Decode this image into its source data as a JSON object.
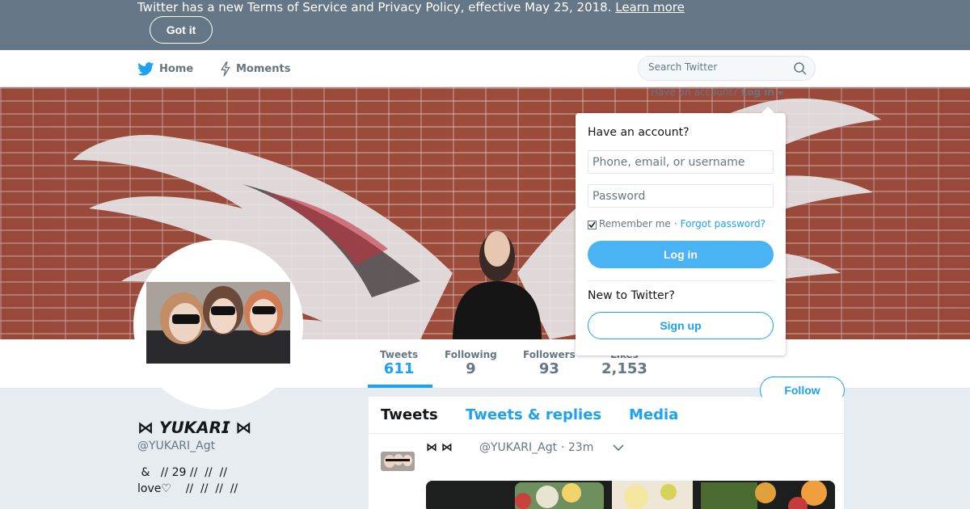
{
  "notice": {
    "text": "Twitter has a new Terms of Service and Privacy Policy, effective May 25, 2018.",
    "link": "Learn more",
    "button": "Got it"
  },
  "nav": {
    "home": "Home",
    "moments": "Moments",
    "search_placeholder": "Search Twitter",
    "have_account": "Have an account?",
    "login_link": "Log in",
    "icons": [
      "twitter-bird-icon",
      "lightning-icon",
      "search-icon",
      "caret-down-icon"
    ]
  },
  "login_dropdown": {
    "heading": "Have an account?",
    "username_placeholder": "Phone, email, or username",
    "password_placeholder": "Password",
    "remember": "Remember me",
    "separator": "·",
    "forgot": "Forgot password?",
    "login_button": "Log in",
    "new_to_twitter": "New to Twitter?",
    "signup_button": "Sign up"
  },
  "stats": [
    {
      "label": "Tweets",
      "value": "611",
      "active": true
    },
    {
      "label": "Following",
      "value": "9"
    },
    {
      "label": "Followers",
      "value": "93"
    },
    {
      "label": "Likes",
      "value": "2,153"
    }
  ],
  "follow_button": "Follow",
  "profile": {
    "name": "⋈ 𝙔𝙐𝙆𝘼𝙍𝙄 ⋈",
    "handle": "@YUKARI_Agt",
    "bio": " &   // 29 //  //  //\nlove♡    //  //  //  //"
  },
  "timeline": {
    "tabs": [
      "Tweets",
      "Tweets & replies",
      "Media"
    ],
    "tweet": {
      "name": "⋈  ⋈",
      "handle": "@YUKARI_Agt",
      "time": "· 23m"
    }
  },
  "colors": {
    "notice_bg": "#657786",
    "accent": "#1da1f2",
    "login_button": "#4ab3f4",
    "page_bg": "#e6ecf0"
  }
}
